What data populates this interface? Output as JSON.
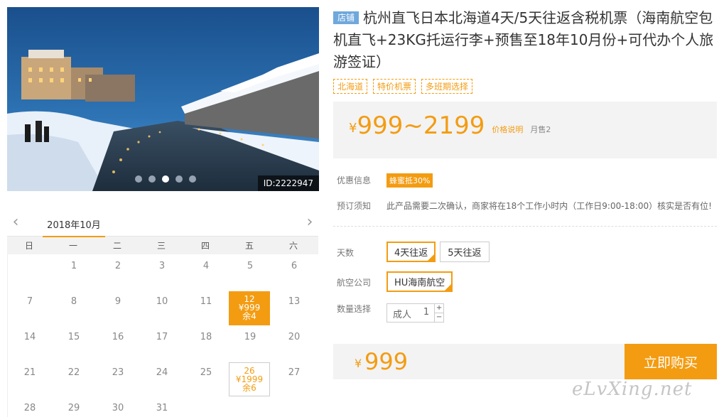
{
  "photo": {
    "id_label": "ID:2222947",
    "slides": 5,
    "active_slide": 3
  },
  "calendar": {
    "month_label": "2018年10月",
    "weekdays": [
      "日",
      "一",
      "二",
      "三",
      "四",
      "五",
      "六"
    ],
    "rows": [
      [
        "",
        "1",
        "2",
        "3",
        "4",
        "5",
        "6"
      ],
      [
        "7",
        "8",
        "9",
        "10",
        "11",
        "12",
        "13"
      ],
      [
        "14",
        "15",
        "16",
        "17",
        "18",
        "19",
        "20"
      ],
      [
        "21",
        "22",
        "23",
        "24",
        "25",
        "26",
        "27"
      ],
      [
        "28",
        "29",
        "30",
        "31",
        "",
        "",
        ""
      ]
    ],
    "priced_days": {
      "12": {
        "price": "¥999",
        "stock": "余4",
        "style": "selected"
      },
      "26": {
        "price": "¥1999",
        "stock": "余6",
        "style": "available"
      }
    }
  },
  "product": {
    "shop_tag": "店铺",
    "title": "杭州直飞日本北海道4天/5天往返含税机票（海南航空包机直飞+23KG托运行李+预售至18年10月份+可代办个人旅游签证）",
    "tags": [
      "北海道",
      "特价机票",
      "多班期选择"
    ]
  },
  "pricing": {
    "currency": "¥",
    "range": "999~2199",
    "explain_link": "价格说明",
    "monthly_sales": "月售2"
  },
  "info": {
    "promo_label": "优惠信息",
    "promo_badge": "蜂蜜抵30%",
    "notice_label": "预订须知",
    "notice_text": "此产品需要二次确认，商家将在18个工作小时内（工作日9:00-18:00）核实是否有位!"
  },
  "options": {
    "days_label": "天数",
    "days": [
      "4天往返",
      "5天往返"
    ],
    "days_selected": "4天往返",
    "airline_label": "航空公司",
    "airline": "HU海南航空",
    "qty_label": "数量选择",
    "qty_type": "成人",
    "qty_value": "1",
    "qty_plus": "+",
    "qty_minus": "−"
  },
  "buy": {
    "currency": "¥",
    "price": "999",
    "button": "立即购买"
  },
  "watermark": "eLvXing.net",
  "colors": {
    "accent": "#f39c12",
    "shop_tag": "#6fa8dc"
  }
}
